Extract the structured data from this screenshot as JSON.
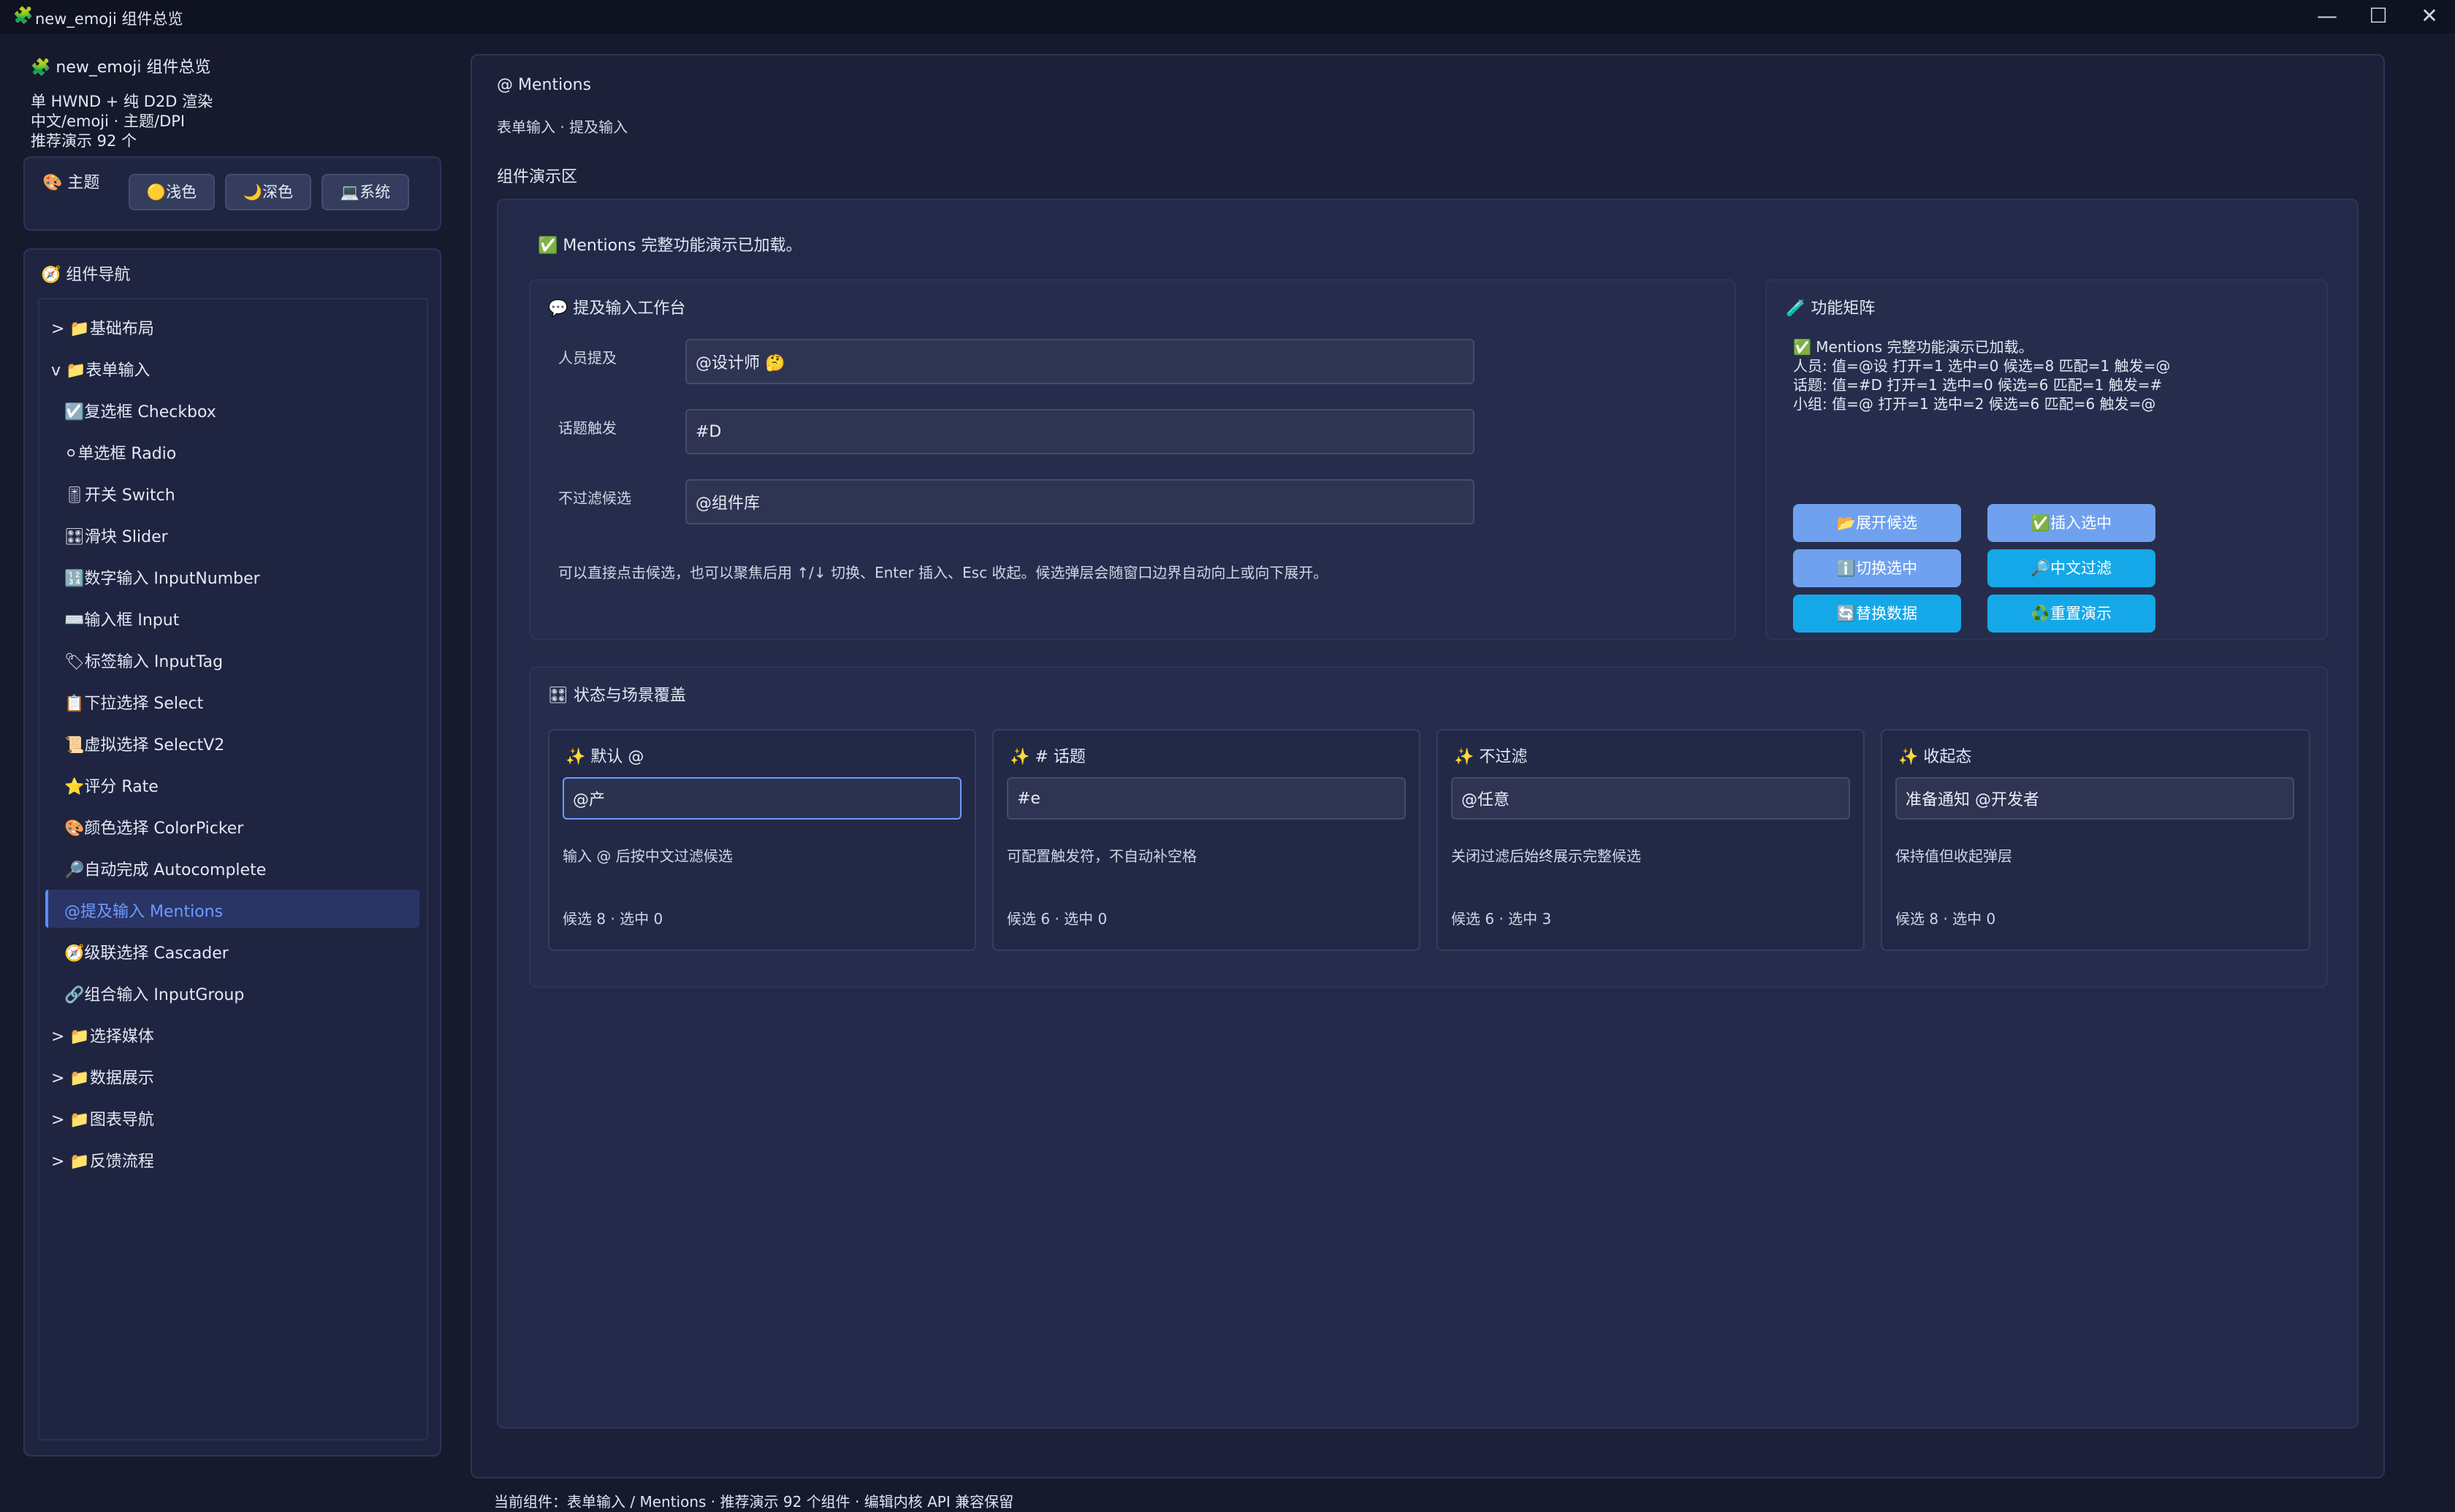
{
  "window": {
    "title": "new_emoji 组件总览",
    "app_icon": "🧩",
    "controls": {
      "minimize": "—",
      "maximize": "☐",
      "close": "✕"
    }
  },
  "sidebar": {
    "app_name": "🧩 new_emoji 组件总览",
    "info": [
      "单 HWND + 纯 D2D 渲染",
      "中文/emoji · 主题/DPI",
      "推荐演示 92 个"
    ],
    "theme": {
      "title": "🎨 主题",
      "buttons": [
        "🟡浅色",
        "🌙深色",
        "💻系统"
      ]
    },
    "nav": {
      "title": "🧭 组件导航",
      "groups_top": [
        {
          "label": "> 📁基础布局"
        }
      ],
      "open_group": "v 📁表单输入",
      "items": [
        "☑️复选框 Checkbox",
        "⚪单选框 Radio",
        "🎚开关 Switch",
        "🎛滑块 Slider",
        "🔢数字输入 InputNumber",
        "⌨️输入框 Input",
        "🏷标签输入 InputTag",
        "📋下拉选择 Select",
        "📜虚拟选择 SelectV2",
        "⭐评分 Rate",
        "🎨颜色选择 ColorPicker",
        "🔎自动完成 Autocomplete",
        "@提及输入 Mentions",
        "🧭级联选择 Cascader",
        "🔗组合输入 InputGroup"
      ],
      "active_index": 12,
      "groups_bottom": [
        "> 📁选择媒体",
        "> 📁数据展示",
        "> 📁图表导航",
        "> 📁反馈流程"
      ]
    }
  },
  "main": {
    "title": "@ Mentions",
    "subtitle": "表单输入 · 提及输入",
    "demo_label": "组件演示区",
    "loaded_msg": "✅ Mentions 完整功能演示已加载。",
    "workbench": {
      "title": "💬 提及输入工作台",
      "rows": [
        {
          "label": "人员提及",
          "value": "@设计师 🤔"
        },
        {
          "label": "话题触发",
          "value": "#D"
        },
        {
          "label": "不过滤候选",
          "value": "@组件库"
        }
      ],
      "hint": "可以直接点击候选，也可以聚焦后用 ↑/↓ 切换、Enter 插入、Esc 收起。候选弹层会随窗口边界自动向上或向下展开。"
    },
    "matrix": {
      "title": "🧪 功能矩阵",
      "lines": [
        "✅ Mentions 完整功能演示已加载。",
        "人员: 值=@设 打开=1 选中=0 候选=8 匹配=1 触发=@",
        "话题: 值=#D 打开=1 选中=0 候选=6 匹配=1 触发=#",
        "小组: 值=@ 打开=1 选中=2 候选=6 匹配=6 触发=@"
      ],
      "buttons": [
        {
          "label": "📂展开候选",
          "style": "light"
        },
        {
          "label": "✅插入选中",
          "style": "light"
        },
        {
          "label": "ℹ️切换选中",
          "style": "light"
        },
        {
          "label": "🔎中文过滤",
          "style": "cyan"
        },
        {
          "label": "🔄替换数据",
          "style": "cyan"
        },
        {
          "label": "♻️重置演示",
          "style": "cyan"
        }
      ]
    },
    "states": {
      "title": "🎛 状态与场景覆盖",
      "cards": [
        {
          "title": "✨ 默认 @",
          "value": "@产",
          "desc": "输入 @ 后按中文过滤候选",
          "foot": "候选 8 · 选中 0"
        },
        {
          "title": "✨ # 话题",
          "value": "#e",
          "desc": "可配置触发符，不自动补空格",
          "foot": "候选 6 · 选中 0"
        },
        {
          "title": "✨ 不过滤",
          "value": "@任意",
          "desc": "关闭过滤后始终展示完整候选",
          "foot": "候选 6 · 选中 3"
        },
        {
          "title": "✨ 收起态",
          "value": "准备通知 @开发者",
          "desc": "保持值但收起弹层",
          "foot": "候选 8 · 选中 0"
        }
      ]
    }
  },
  "status_bar": "当前组件：表单输入 / Mentions · 推荐演示 92 个组件 · 编辑内核 API 兼容保留",
  "colors": {
    "background": "#161a2c",
    "panel": "#1f2540",
    "accent": "#6e9bff",
    "button_light": "#6fa1ef",
    "button_cyan": "#15a8e8"
  }
}
